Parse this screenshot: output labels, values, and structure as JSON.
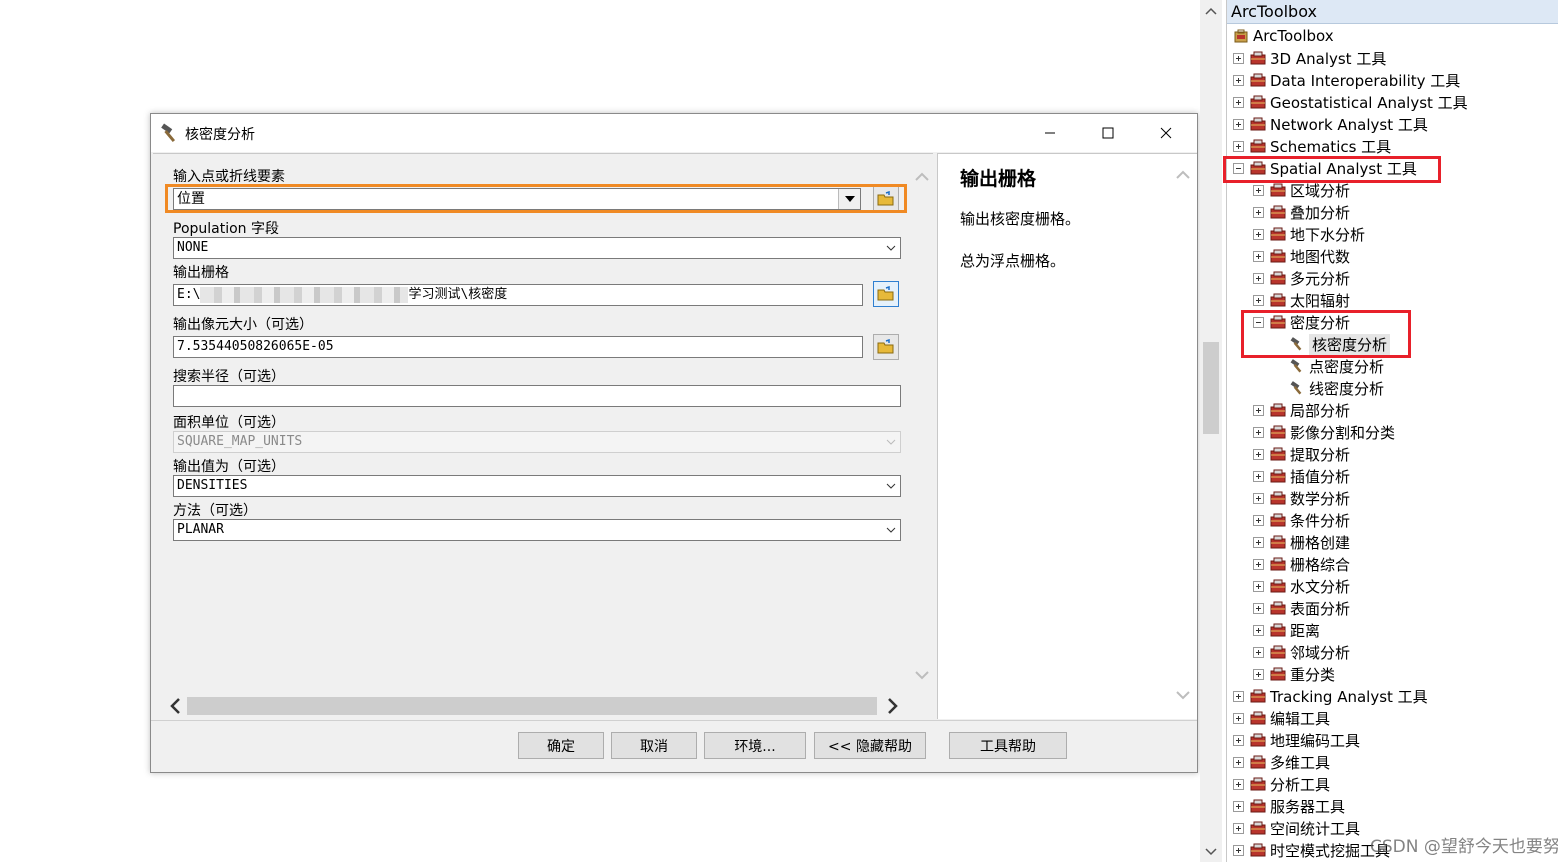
{
  "dialog": {
    "title": "核密度分析",
    "icon": "hammer-icon",
    "window_buttons": [
      "minimize-icon",
      "maximize-icon",
      "close-icon"
    ],
    "fields": [
      {
        "label": "输入点或折线要素",
        "value": "位置",
        "type": "dropdown-browse"
      },
      {
        "label": "Population 字段",
        "value": "NONE",
        "type": "dropdown"
      },
      {
        "label": "输出栅格",
        "value_prefix": "E:\\",
        "value_suffix": "学习测试\\核密度",
        "type": "text-browse"
      },
      {
        "label": "输出像元大小（可选）",
        "value": "7.53544050826065E-05",
        "type": "text-browse"
      },
      {
        "label": "搜索半径（可选）",
        "value": "",
        "type": "text"
      },
      {
        "label": "面积单位（可选）",
        "value": "SQUARE_MAP_UNITS",
        "type": "dropdown-disabled"
      },
      {
        "label": "输出值为（可选）",
        "value": "DENSITIES",
        "type": "dropdown"
      },
      {
        "label": "方法（可选）",
        "value": "PLANAR",
        "type": "dropdown"
      }
    ],
    "help": {
      "title": "输出栅格",
      "paragraphs": [
        "输出核密度栅格。",
        "总为浮点栅格。"
      ]
    },
    "buttons": {
      "ok": "确定",
      "cancel": "取消",
      "env": "环境...",
      "hide_help": "<< 隐藏帮助",
      "tool_help": "工具帮助"
    }
  },
  "toolbox": {
    "header": "ArcToolbox",
    "root": "ArcToolbox",
    "items": [
      {
        "label": "3D Analyst 工具",
        "level": 1,
        "expander": "plus"
      },
      {
        "label": "Data Interoperability 工具",
        "level": 1,
        "expander": "plus"
      },
      {
        "label": "Geostatistical Analyst 工具",
        "level": 1,
        "expander": "plus"
      },
      {
        "label": "Network Analyst 工具",
        "level": 1,
        "expander": "plus"
      },
      {
        "label": "Schematics 工具",
        "level": 1,
        "expander": "plus"
      },
      {
        "label": "Spatial Analyst 工具",
        "level": 1,
        "expander": "minus"
      },
      {
        "label": "区域分析",
        "level": 2,
        "expander": "plus"
      },
      {
        "label": "叠加分析",
        "level": 2,
        "expander": "plus"
      },
      {
        "label": "地下水分析",
        "level": 2,
        "expander": "plus"
      },
      {
        "label": "地图代数",
        "level": 2,
        "expander": "plus"
      },
      {
        "label": "多元分析",
        "level": 2,
        "expander": "plus"
      },
      {
        "label": "太阳辐射",
        "level": 2,
        "expander": "plus"
      },
      {
        "label": "密度分析",
        "level": 2,
        "expander": "minus"
      },
      {
        "label": "核密度分析",
        "level": 3,
        "expander": "none",
        "selected": true
      },
      {
        "label": "点密度分析",
        "level": 3,
        "expander": "none"
      },
      {
        "label": "线密度分析",
        "level": 3,
        "expander": "none"
      },
      {
        "label": "局部分析",
        "level": 2,
        "expander": "plus"
      },
      {
        "label": "影像分割和分类",
        "level": 2,
        "expander": "plus"
      },
      {
        "label": "提取分析",
        "level": 2,
        "expander": "plus"
      },
      {
        "label": "插值分析",
        "level": 2,
        "expander": "plus"
      },
      {
        "label": "数学分析",
        "level": 2,
        "expander": "plus"
      },
      {
        "label": "条件分析",
        "level": 2,
        "expander": "plus"
      },
      {
        "label": "栅格创建",
        "level": 2,
        "expander": "plus"
      },
      {
        "label": "栅格综合",
        "level": 2,
        "expander": "plus"
      },
      {
        "label": "水文分析",
        "level": 2,
        "expander": "plus"
      },
      {
        "label": "表面分析",
        "level": 2,
        "expander": "plus"
      },
      {
        "label": "距离",
        "level": 2,
        "expander": "plus"
      },
      {
        "label": "邻域分析",
        "level": 2,
        "expander": "plus"
      },
      {
        "label": "重分类",
        "level": 2,
        "expander": "plus"
      },
      {
        "label": "Tracking Analyst 工具",
        "level": 1,
        "expander": "plus"
      },
      {
        "label": "编辑工具",
        "level": 1,
        "expander": "plus"
      },
      {
        "label": "地理编码工具",
        "level": 1,
        "expander": "plus"
      },
      {
        "label": "多维工具",
        "level": 1,
        "expander": "plus"
      },
      {
        "label": "分析工具",
        "level": 1,
        "expander": "plus"
      },
      {
        "label": "服务器工具",
        "level": 1,
        "expander": "plus"
      },
      {
        "label": "空间统计工具",
        "level": 1,
        "expander": "plus"
      },
      {
        "label": "时空模式挖掘工具",
        "level": 1,
        "expander": "plus"
      }
    ]
  },
  "watermark": "CSDN @望舒今天也要努力哇",
  "colors": {
    "highlight_orange": "#f08a24",
    "highlight_red": "#e8202a",
    "toolbox_red": "#b8342c"
  }
}
